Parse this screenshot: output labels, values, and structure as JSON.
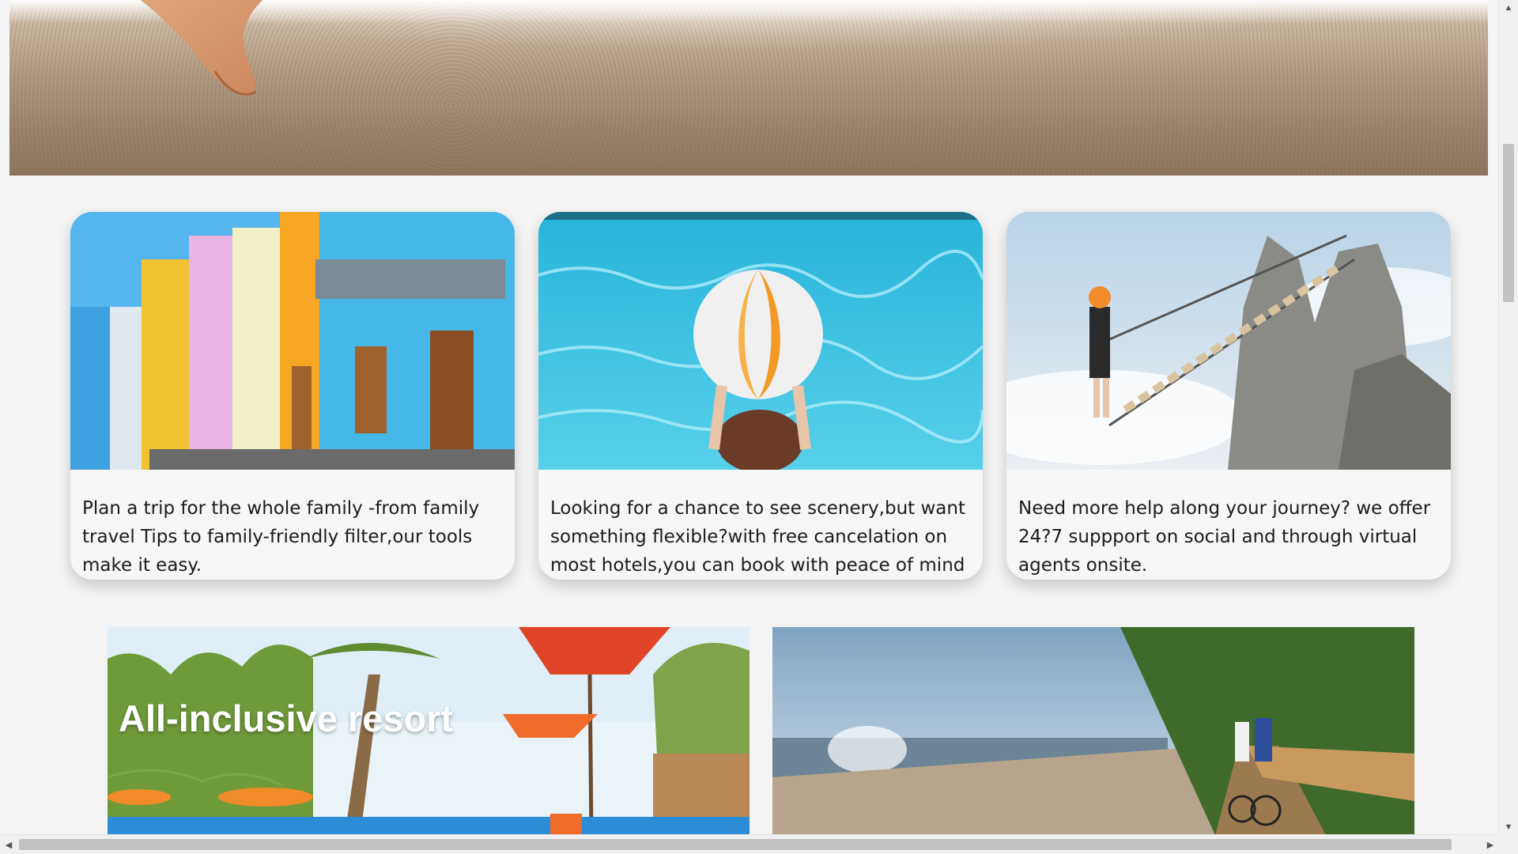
{
  "hero": {
    "image_icon": "beach-sand-starfish-image"
  },
  "cards": [
    {
      "image_icon": "colorful-street-houses-image",
      "text": "Plan a trip for the whole family -from family travel Tips to family-friendly filter,our tools make it easy."
    },
    {
      "image_icon": "pool-beach-ball-image",
      "text": "Looking for a chance to see scenery,but want something flexible?with free cancelation on most hotels,you can book with peace of mind"
    },
    {
      "image_icon": "rope-bridge-climber-image",
      "text": "Need more help along your journey? we offer 24?7 suppport on social and through virtual agents onsite."
    }
  ],
  "promos": [
    {
      "image_icon": "resort-umbrellas-palms-image",
      "title": "All-inclusive resort"
    },
    {
      "image_icon": "coastal-boardwalk-cyclists-image",
      "title": ""
    }
  ],
  "scrollbars": {
    "up_arrow": "▲",
    "down_arrow": "▼",
    "left_arrow": "◀",
    "right_arrow": "▶"
  },
  "colors": {
    "page_background": "#f4f4f4",
    "card_background": "#f6f6f6",
    "text": "#1c1c1c",
    "overlay_title": "#ffffff"
  }
}
